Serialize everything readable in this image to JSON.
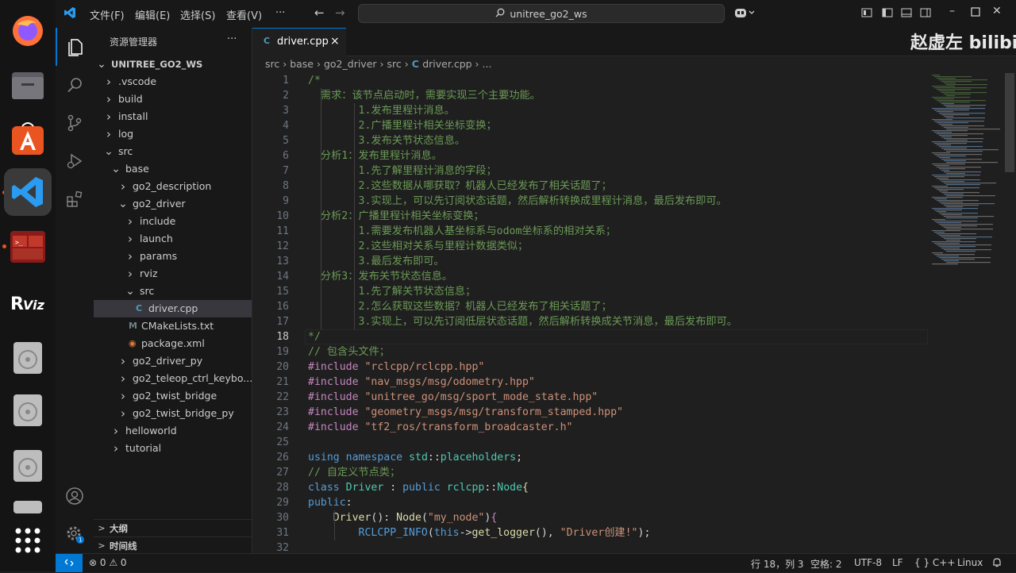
{
  "menu": [
    "文件(F)",
    "编辑(E)",
    "选择(S)",
    "查看(V)",
    "···"
  ],
  "command_center": "unitree_go2_ws",
  "sidebar": {
    "title": "资源管理器",
    "more": "···",
    "tree": [
      {
        "label": "UNITREE_GO2_WS",
        "chev": "v",
        "icon": "",
        "indent": 0,
        "bold": true
      },
      {
        "label": ".vscode",
        "chev": ">",
        "icon": "",
        "indent": 1
      },
      {
        "label": "build",
        "chev": ">",
        "icon": "",
        "indent": 1
      },
      {
        "label": "install",
        "chev": ">",
        "icon": "",
        "indent": 1
      },
      {
        "label": "log",
        "chev": ">",
        "icon": "",
        "indent": 1
      },
      {
        "label": "src",
        "chev": "v",
        "icon": "",
        "indent": 1
      },
      {
        "label": "base",
        "chev": "v",
        "icon": "",
        "indent": 2
      },
      {
        "label": "go2_description",
        "chev": ">",
        "icon": "",
        "indent": 3
      },
      {
        "label": "go2_driver",
        "chev": "v",
        "icon": "",
        "indent": 3
      },
      {
        "label": "include",
        "chev": ">",
        "icon": "",
        "indent": 4
      },
      {
        "label": "launch",
        "chev": ">",
        "icon": "",
        "indent": 4
      },
      {
        "label": "params",
        "chev": ">",
        "icon": "",
        "indent": 4
      },
      {
        "label": "rviz",
        "chev": ">",
        "icon": "",
        "indent": 4
      },
      {
        "label": "src",
        "chev": "v",
        "icon": "",
        "indent": 4
      },
      {
        "label": "driver.cpp",
        "chev": "",
        "icon": "C",
        "indent": 5,
        "selected": true
      },
      {
        "label": "CMakeLists.txt",
        "chev": "",
        "icon": "M",
        "indent": 4
      },
      {
        "label": "package.xml",
        "chev": "",
        "icon": "rss",
        "indent": 4
      },
      {
        "label": "go2_driver_py",
        "chev": ">",
        "icon": "",
        "indent": 3
      },
      {
        "label": "go2_teleop_ctrl_keybo...",
        "chev": ">",
        "icon": "",
        "indent": 3
      },
      {
        "label": "go2_twist_bridge",
        "chev": ">",
        "icon": "",
        "indent": 3
      },
      {
        "label": "go2_twist_bridge_py",
        "chev": ">",
        "icon": "",
        "indent": 3
      },
      {
        "label": "helloworld",
        "chev": ">",
        "icon": "",
        "indent": 2
      },
      {
        "label": "tutorial",
        "chev": ">",
        "icon": "",
        "indent": 2
      }
    ],
    "outline": "大纲",
    "timeline": "时间线"
  },
  "tab": {
    "label": "driver.cpp",
    "close": "×"
  },
  "breadcrumb": [
    "src",
    "base",
    "go2_driver",
    "src",
    "driver.cpp",
    "..."
  ],
  "current_line": 18,
  "code_lines": [
    [
      {
        "c": "cmt",
        "t": "/*"
      }
    ],
    [
      {
        "c": "cmt",
        "t": "  需求：该节点启动时，需要实现三个主要功能。"
      }
    ],
    [
      {
        "c": "cmt",
        "t": "        1.发布里程计消息。"
      }
    ],
    [
      {
        "c": "cmt",
        "t": "        2.广播里程计相关坐标变换；"
      }
    ],
    [
      {
        "c": "cmt",
        "t": "        3.发布关节状态信息。"
      }
    ],
    [
      {
        "c": "cmt",
        "t": "  分析1：发布里程计消息。"
      }
    ],
    [
      {
        "c": "cmt",
        "t": "        1.先了解里程计消息的字段；"
      }
    ],
    [
      {
        "c": "cmt",
        "t": "        2.这些数据从哪获取？机器人已经发布了相关话题了；"
      }
    ],
    [
      {
        "c": "cmt",
        "t": "        3.实现上，可以先订阅状态话题，然后解析转换成里程计消息，最后发布即可。"
      }
    ],
    [
      {
        "c": "cmt",
        "t": "  分析2：广播里程计相关坐标变换；"
      }
    ],
    [
      {
        "c": "cmt",
        "t": "        1.需要发布机器人基坐标系与odom坐标系的相对关系；"
      }
    ],
    [
      {
        "c": "cmt",
        "t": "        2.这些相对关系与里程计数据类似；"
      }
    ],
    [
      {
        "c": "cmt",
        "t": "        3.最后发布即可。"
      }
    ],
    [
      {
        "c": "cmt",
        "t": "  分析3：发布关节状态信息。"
      }
    ],
    [
      {
        "c": "cmt",
        "t": "        1.先了解关节状态信息；"
      }
    ],
    [
      {
        "c": "cmt",
        "t": "        2.怎么获取这些数据？机器人已经发布了相关话题了；"
      }
    ],
    [
      {
        "c": "cmt",
        "t": "        3.实现上，可以先订阅低层状态话题，然后解析转换成关节消息，最后发布即可。"
      }
    ],
    [
      {
        "c": "cmt",
        "t": "*/"
      }
    ],
    [
      {
        "c": "cmt",
        "t": "// 包含头文件；"
      }
    ],
    [
      {
        "c": "pp",
        "t": "#include "
      },
      {
        "c": "str",
        "t": "\"rclcpp/rclcpp.hpp\""
      }
    ],
    [
      {
        "c": "pp",
        "t": "#include "
      },
      {
        "c": "str",
        "t": "\"nav_msgs/msg/odometry.hpp\""
      }
    ],
    [
      {
        "c": "pp",
        "t": "#include "
      },
      {
        "c": "str",
        "t": "\"unitree_go/msg/sport_mode_state.hpp\""
      }
    ],
    [
      {
        "c": "pp",
        "t": "#include "
      },
      {
        "c": "str",
        "t": "\"geometry_msgs/msg/transform_stamped.hpp\""
      }
    ],
    [
      {
        "c": "pp",
        "t": "#include "
      },
      {
        "c": "str",
        "t": "\"tf2_ros/transform_broadcaster.h\""
      }
    ],
    [],
    [
      {
        "c": "kw",
        "t": "using"
      },
      {
        "c": "txt",
        "t": " "
      },
      {
        "c": "kw",
        "t": "namespace"
      },
      {
        "c": "txt",
        "t": " "
      },
      {
        "c": "typ",
        "t": "std"
      },
      {
        "c": "txt",
        "t": "::"
      },
      {
        "c": "typ",
        "t": "placeholders"
      },
      {
        "c": "txt",
        "t": ";"
      }
    ],
    [
      {
        "c": "cmt",
        "t": "// 自定义节点类；"
      }
    ],
    [
      {
        "c": "kw",
        "t": "class"
      },
      {
        "c": "txt",
        "t": " "
      },
      {
        "c": "typ",
        "t": "Driver"
      },
      {
        "c": "txt",
        "t": " : "
      },
      {
        "c": "kw",
        "t": "public"
      },
      {
        "c": "txt",
        "t": " "
      },
      {
        "c": "typ",
        "t": "rclcpp"
      },
      {
        "c": "txt",
        "t": "::"
      },
      {
        "c": "typ",
        "t": "Node"
      },
      {
        "c": "fn",
        "t": "{"
      }
    ],
    [
      {
        "c": "kw",
        "t": "public"
      },
      {
        "c": "txt",
        "t": ":"
      }
    ],
    [
      {
        "c": "txt",
        "t": "    "
      },
      {
        "c": "fn",
        "t": "Driver"
      },
      {
        "c": "txt",
        "t": "(): "
      },
      {
        "c": "fn",
        "t": "Node"
      },
      {
        "c": "txt",
        "t": "("
      },
      {
        "c": "str",
        "t": "\"my_node\""
      },
      {
        "c": "txt",
        "t": ")"
      },
      {
        "c": "pp",
        "t": "{"
      }
    ],
    [
      {
        "c": "txt",
        "t": "        "
      },
      {
        "c": "kw",
        "t": "RCLCPP_INFO"
      },
      {
        "c": "txt",
        "t": "("
      },
      {
        "c": "kw",
        "t": "this"
      },
      {
        "c": "txt",
        "t": "->"
      },
      {
        "c": "fn",
        "t": "get_logger"
      },
      {
        "c": "txt",
        "t": "(), "
      },
      {
        "c": "str",
        "t": "\"Driver创建!\""
      },
      {
        "c": "txt",
        "t": ");"
      }
    ],
    []
  ],
  "status": {
    "problems": "⊗ 0 ⚠ 0",
    "position": "行 18，列 3",
    "spaces": "空格: 2",
    "encoding": "UTF-8",
    "eol": "LF",
    "language": "{ } C++",
    "platform": "Linux",
    "remote_icon": "remote-icon"
  },
  "watermark": "赵虚左 bilibili",
  "colors": {
    "accent": "#0078d4",
    "ubuntu": "#e95420",
    "comment": "#6a9955",
    "keyword": "#569cd6",
    "string": "#ce9178",
    "type": "#4ec9b0",
    "function": "#dcdcaa"
  }
}
